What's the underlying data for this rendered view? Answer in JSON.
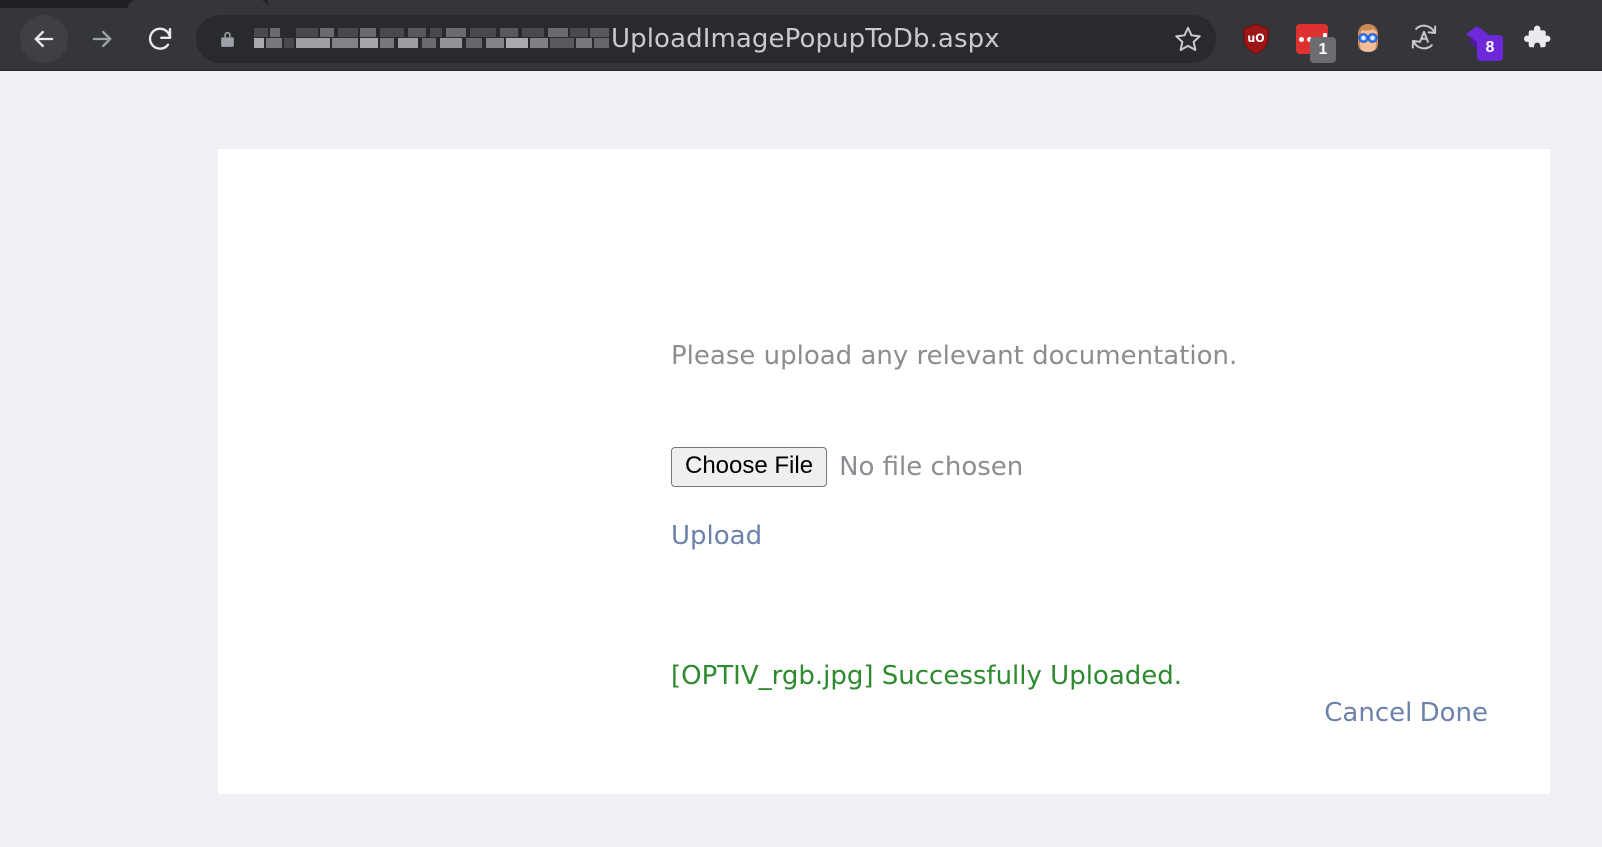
{
  "browser": {
    "nav": {
      "back_label": "Back",
      "back_icon": "arrow-left-icon",
      "forward_label": "Forward",
      "forward_icon": "arrow-right-icon",
      "reload_label": "Reload",
      "reload_icon": "reload-icon"
    },
    "omnibox": {
      "lock_icon": "lock-icon",
      "url_visible_text": "UploadImagePopupToDb.aspx",
      "url_redacted": true,
      "bookmark_icon": "star-icon",
      "bookmark_label": "Bookmark this tab"
    },
    "extensions": [
      {
        "name": "ublock-origin",
        "icon": "shield-icon",
        "glyph": "uO",
        "color": "#9b1616",
        "badge": ""
      },
      {
        "name": "red-dots-extension",
        "icon": "dots-icon",
        "color": "#e03131",
        "badge": "1",
        "badge_color": "#6b6d70"
      },
      {
        "name": "avatar-goggles-extension",
        "icon": "face-goggles-icon",
        "color": "#3b82f6",
        "badge": ""
      },
      {
        "name": "translate-extension",
        "icon": "translate-a-icon",
        "color": "#c8cace",
        "badge": ""
      },
      {
        "name": "purple-diamond-extension",
        "icon": "diamond-stack-icon",
        "color": "#6d28d9",
        "badge": "8",
        "badge_color": "#6d28d9"
      },
      {
        "name": "extensions-menu",
        "icon": "puzzle-piece-icon",
        "color": "#e8eaed",
        "badge": ""
      }
    ],
    "colors": {
      "chrome_bg": "#35363a",
      "omnibox_bg": "#292a2d",
      "tab_strip_bg": "#202124",
      "url_text": "#c8cace"
    }
  },
  "page": {
    "background": "#f0f1f4",
    "card_background": "#ffffff",
    "prompt": "Please upload any relevant documentation.",
    "file_input": {
      "button_label": "Choose File",
      "status_text": "No file chosen",
      "name": "file-upload-input"
    },
    "upload_link": "Upload",
    "status_message": "[OPTIV_rgb.jpg] Successfully Uploaded.",
    "status_color": "#2e8a2e",
    "uploaded_file_name": "OPTIV_rgb.jpg",
    "actions": {
      "cancel_label": "Cancel",
      "done_label": "Done",
      "link_color": "#6d82ab"
    }
  }
}
